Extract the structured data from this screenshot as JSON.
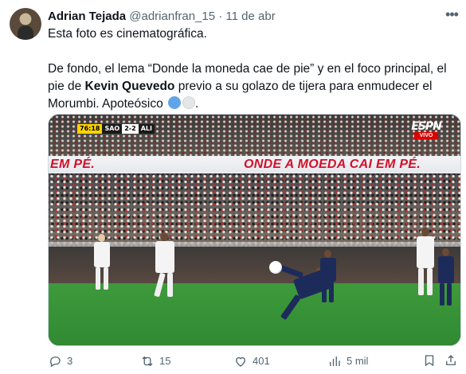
{
  "tweet": {
    "author_name": "Adrian Tejada",
    "handle": "@adrianfran_15",
    "separator": "·",
    "date": "11 de abr",
    "text_line1": "Esta foto es cinematográfica.",
    "text_p2_part1": "De fondo, el lema “Donde la moneda cae de pie” y en el foco principal, el pie de ",
    "text_p2_bold": "Kevin Quevedo",
    "text_p2_part2": " previo a su golazo de tijera para enmudecer el Morumbi. Apoteósico ",
    "emoji": [
      "light-blue-circle",
      "white-circle"
    ]
  },
  "media": {
    "scorebug": {
      "clock": "76:18",
      "home": "SAO",
      "score": "2-2",
      "away": "ALI"
    },
    "broadcaster": "ESPN",
    "broadcaster_badge": "VIVO",
    "banner_left": "EM PÉ.",
    "banner_main": "ONDE A MOEDA CAI EM PÉ."
  },
  "actions": {
    "replies": "3",
    "retweets": "15",
    "likes": "401",
    "views": "5 mil"
  },
  "colors": {
    "text": "#0f1419",
    "secondary": "#536471",
    "banner_red": "#d2102a",
    "pitch_green": "#3f9a3c"
  }
}
